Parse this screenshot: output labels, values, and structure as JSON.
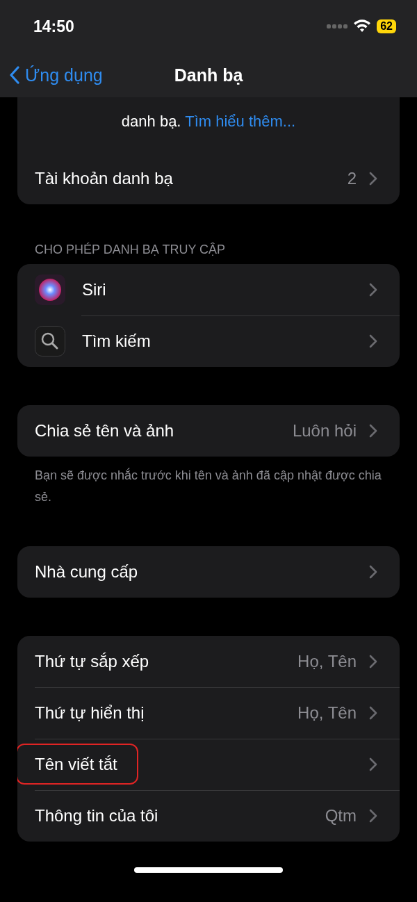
{
  "status_bar": {
    "time": "14:50",
    "battery": "62"
  },
  "nav": {
    "back": "Ứng dụng",
    "title": "Danh bạ"
  },
  "sections": [
    {
      "rows": [
        {
          "kind": "text",
          "text": "danh bạ. **Tìm hiểu thêm...**"
        },
        {
          "kind": "row",
          "label": "Tài khoản danh bạ",
          "value": "2",
          "highlighted": false
        }
      ]
    },
    {
      "header": "CHO PHÉP DANH BẠ TRUY CẬP",
      "rows": [
        {
          "kind": "app",
          "label": "Siri",
          "highlighted": false
        },
        {
          "kind": "app",
          "label": "Tìm kiếm",
          "highlighted": false
        }
      ]
    },
    {
      "rows": [
        {
          "kind": "row",
          "label": "Chia sẻ tên và ảnh",
          "value": "Luôn hỏi",
          "highlighted": false
        }
      ],
      "footer": "Bạn sẽ được nhắc trước khi tên và ảnh đã cập nhật được chia sẻ."
    },
    {
      "rows": [
        {
          "kind": "row",
          "label": "Nhà cung cấp",
          "highlighted": false
        }
      ]
    },
    {
      "rows": [
        {
          "kind": "row",
          "label": "Thứ tự sắp xếp",
          "value": "Họ, Tên",
          "highlighted": false
        },
        {
          "kind": "row",
          "label": "Thứ tự hiển thị",
          "value": "Họ, Tên",
          "highlighted": false
        },
        {
          "kind": "row",
          "label": "Tên viết tắt",
          "highlighted": true
        },
        {
          "kind": "row",
          "label": "Thông tin của tôi",
          "value": "Qtm",
          "highlighted": false
        }
      ]
    }
  ]
}
